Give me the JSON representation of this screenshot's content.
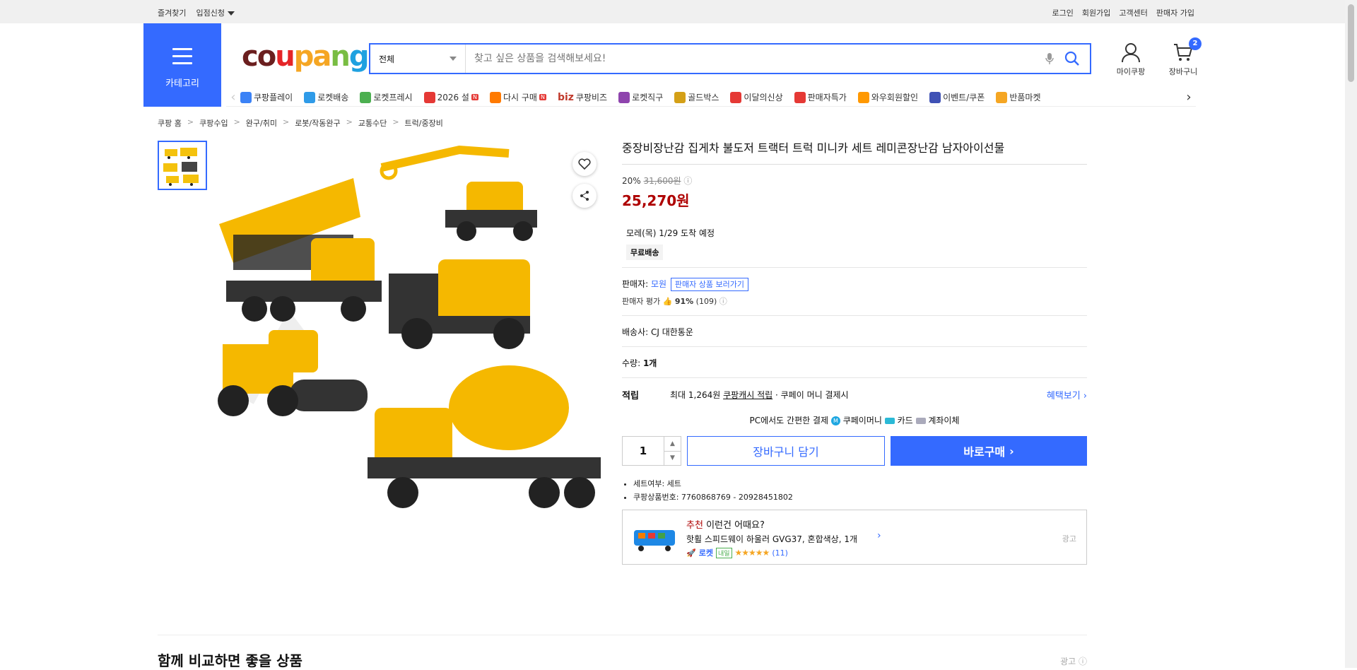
{
  "topbar": {
    "left": [
      "즐겨찾기",
      "입점신청"
    ],
    "right": [
      "로그인",
      "회원가입",
      "고객센터",
      "판매자 가입"
    ]
  },
  "category_label": "카테고리",
  "logo": {
    "c": "c",
    "o": "o",
    "u": "u",
    "p": "p",
    "a": "a",
    "n": "n",
    "g": "g"
  },
  "search": {
    "category": "전체",
    "placeholder": "찾고 싶은 상품을 검색해보세요!"
  },
  "user": {
    "mypage": "마이쿠팡",
    "cart": "장바구니",
    "cart_count": "2"
  },
  "nav": [
    {
      "label": "쿠팡플레이",
      "icon": "play-icon",
      "color": "#3b82f6"
    },
    {
      "label": "로켓배송",
      "icon": "rocket-icon",
      "color": "#2f9be8"
    },
    {
      "label": "로켓프레시",
      "icon": "fresh-rocket-icon",
      "color": "#4caf50"
    },
    {
      "label": "2026 설",
      "icon": "gift-icon",
      "color": "#e53935",
      "badge": "N"
    },
    {
      "label": "다시 구매",
      "icon": "rebuy-icon",
      "color": "#ff7a00",
      "badge": "N"
    },
    {
      "label": "쿠팡비즈",
      "icon": "biz-icon",
      "color": "#c0392b",
      "prefix": "biz"
    },
    {
      "label": "로켓직구",
      "icon": "global-icon",
      "color": "#8e44ad"
    },
    {
      "label": "골드박스",
      "icon": "goldbox-icon",
      "color": "#d4a017"
    },
    {
      "label": "이달의신상",
      "icon": "new-bag-icon",
      "color": "#e53935"
    },
    {
      "label": "판매자특가",
      "icon": "percent-icon",
      "color": "#e53935"
    },
    {
      "label": "와우회원할인",
      "icon": "wow-icon",
      "color": "#ff9800"
    },
    {
      "label": "이벤트/쿠폰",
      "icon": "coupon-icon",
      "color": "#3f51b5"
    },
    {
      "label": "반품마켓",
      "icon": "market-icon",
      "color": "#f5a623"
    }
  ],
  "breadcrumb": [
    "쿠팡 홈",
    "쿠팡수입",
    "완구/취미",
    "로봇/작동완구",
    "교통수단",
    "트럭/중장비"
  ],
  "product": {
    "title": "중장비장난감 집게차 불도저 트랙터 트럭 미니카 세트 레미콘장난감 남자아이선물",
    "discount": "20%",
    "original_price": "31,600원",
    "price": "25,270원",
    "delivery": "모레(목) 1/29 도착 예정",
    "free_shipping": "무료배송",
    "seller_label": "판매자:",
    "seller": "모원",
    "seller_btn": "판매자 상품 보러가기",
    "seller_rating_label": "판매자 평가",
    "seller_rating": "91%",
    "seller_reviews": "(109)",
    "carrier": "배송사:  CJ 대한통운",
    "qty_label": "수량:",
    "qty_value": "1개",
    "points_label": "적립",
    "points_text1": "최대 1,264원",
    "points_text2": "쿠팡캐시 적립",
    "points_text3": "· 쿠페이 머니 결제시",
    "points_more": "혜택보기",
    "pay_label": "PC에서도 간편한 결제",
    "pay_coupay": "쿠페이머니",
    "pay_card": "카드",
    "pay_bank": "계좌이체",
    "qty_input": "1",
    "cart_btn": "장바구니 담기",
    "buy_btn": "바로구매",
    "bullets": [
      "세트여부: 세트",
      "쿠팡상품번호: 7760868769 - 20928451802"
    ]
  },
  "recommend": {
    "t1_red": "추천",
    "t1": "이런건 어때요?",
    "t2": "핫휠 스피드웨이 하울러 GVG37, 혼합색상, 1개",
    "rocket": "로켓",
    "tomorrow": "내일",
    "stars": "★★★★★",
    "count": "(11)",
    "ad": "광고"
  },
  "compare": {
    "title": "함께 비교하면 좋을 상품",
    "ad": "광고"
  },
  "colors": {
    "accent": "#346aff",
    "price": "#ae0000"
  }
}
